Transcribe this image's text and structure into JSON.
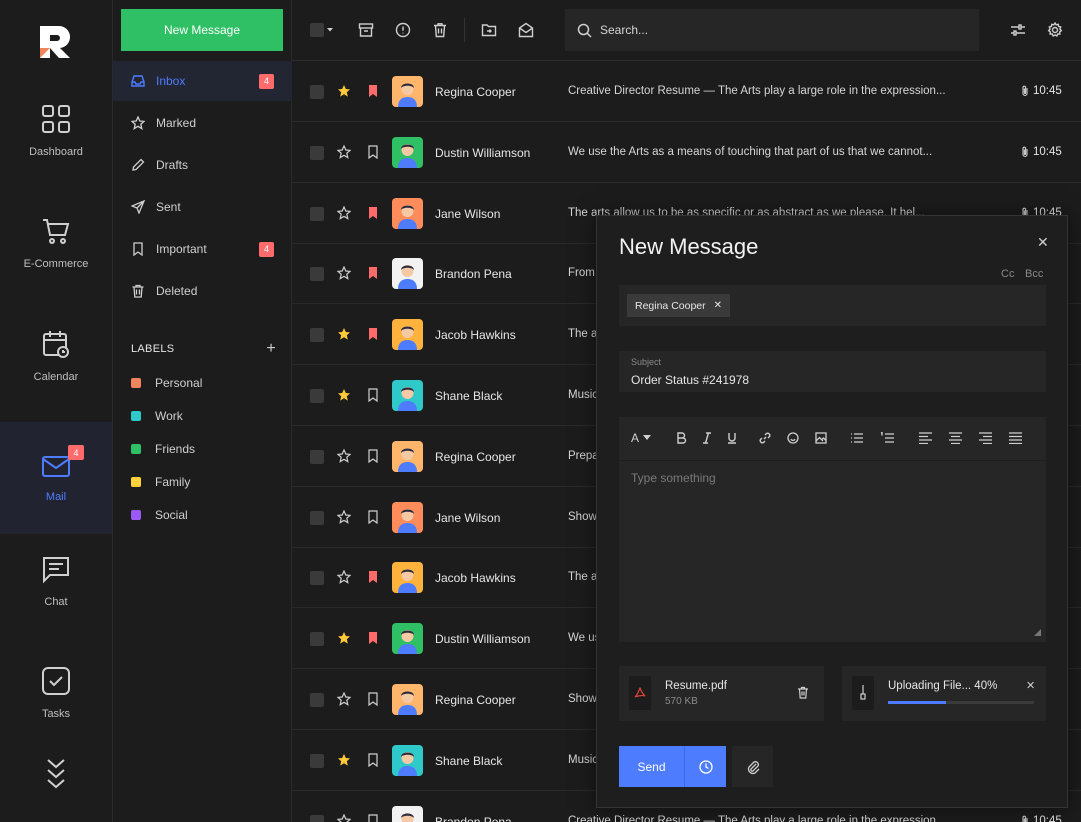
{
  "colors": {
    "accent": "#4e7cff",
    "new_button": "#2fbf64",
    "badge": "#ff6b6b",
    "star": "#ffc93c",
    "bookmark": "#ff6b6b"
  },
  "rail": {
    "items": [
      {
        "label": "Dashboard",
        "icon": "grid-icon"
      },
      {
        "label": "E-Commerce",
        "icon": "cart-icon"
      },
      {
        "label": "Calendar",
        "icon": "calendar-icon"
      },
      {
        "label": "Mail",
        "icon": "mail-icon",
        "badge": "4",
        "active": true
      },
      {
        "label": "Chat",
        "icon": "chat-icon"
      },
      {
        "label": "Tasks",
        "icon": "tasks-icon"
      }
    ]
  },
  "folders": {
    "new_message": "New Message",
    "items": [
      {
        "label": "Inbox",
        "count": "4",
        "active": true
      },
      {
        "label": "Marked"
      },
      {
        "label": "Drafts"
      },
      {
        "label": "Sent"
      },
      {
        "label": "Important",
        "count": "4"
      },
      {
        "label": "Deleted"
      }
    ],
    "labels_heading": "LABELS",
    "labels": [
      {
        "label": "Personal",
        "color": "#f0845c"
      },
      {
        "label": "Work",
        "color": "#2fc9c9"
      },
      {
        "label": "Friends",
        "color": "#2fbf64"
      },
      {
        "label": "Family",
        "color": "#ffd23c"
      },
      {
        "label": "Social",
        "color": "#9b59f5"
      }
    ]
  },
  "search": {
    "placeholder": "Search..."
  },
  "messages": [
    {
      "name": "Regina Cooper",
      "snippet": "Creative Director Resume — The Arts play a large role in the expression...",
      "time": "10:45",
      "attachment": true,
      "starred": true,
      "bookmarked": true,
      "avatar_bg": "#ffb56b"
    },
    {
      "name": "Dustin Williamson",
      "snippet": "We use the Arts as a means of touching that part of us that we cannot...",
      "time": "10:45",
      "attachment": true,
      "starred": false,
      "bookmarked": false,
      "avatar_bg": "#2fbf64"
    },
    {
      "name": "Jane Wilson",
      "snippet": "The arts allow us to be as specific or as abstract as we please. It hel...",
      "time": "10:45",
      "attachment": true,
      "starred": false,
      "bookmarked": true,
      "avatar_bg": "#ff8c5a"
    },
    {
      "name": "Brandon Pena",
      "snippet": "From",
      "time": "",
      "attachment": false,
      "starred": false,
      "bookmarked": true,
      "avatar_bg": "#f2f2f2"
    },
    {
      "name": "Jacob Hawkins",
      "snippet": "The a",
      "time": "",
      "attachment": false,
      "starred": true,
      "bookmarked": true,
      "avatar_bg": "#ffb23c"
    },
    {
      "name": "Shane Black",
      "snippet": "Music",
      "time": "",
      "attachment": false,
      "starred": true,
      "bookmarked": false,
      "avatar_bg": "#2fc9c9"
    },
    {
      "name": "Regina Cooper",
      "snippet": "Prepa",
      "time": "",
      "attachment": false,
      "starred": false,
      "bookmarked": false,
      "avatar_bg": "#ffb56b"
    },
    {
      "name": "Jane Wilson",
      "snippet": "Show",
      "time": "",
      "attachment": false,
      "starred": false,
      "bookmarked": false,
      "avatar_bg": "#ff8c5a"
    },
    {
      "name": "Jacob Hawkins",
      "snippet": "The a",
      "time": "",
      "attachment": false,
      "starred": false,
      "bookmarked": true,
      "avatar_bg": "#ffb23c"
    },
    {
      "name": "Dustin Williamson",
      "snippet": "We us",
      "time": "",
      "attachment": false,
      "starred": true,
      "bookmarked": true,
      "avatar_bg": "#2fbf64"
    },
    {
      "name": "Regina Cooper",
      "snippet": "Show",
      "time": "",
      "attachment": false,
      "starred": false,
      "bookmarked": false,
      "avatar_bg": "#ffb56b"
    },
    {
      "name": "Shane Black",
      "snippet": "Music",
      "time": "",
      "attachment": false,
      "starred": true,
      "bookmarked": false,
      "avatar_bg": "#2fc9c9"
    },
    {
      "name": "Brandon Pena",
      "snippet": "Creative Director Resume — The Arts play a large role in the expression...",
      "time": "10:45",
      "attachment": true,
      "starred": false,
      "bookmarked": false,
      "avatar_bg": "#f2f2f2"
    }
  ],
  "compose": {
    "title": "New Message",
    "cc": "Cc",
    "bcc": "Bcc",
    "recipient": "Regina Cooper",
    "subject_label": "Subject",
    "subject": "Order Status #241978",
    "body_placeholder": "Type something",
    "font_button": "A",
    "attachments": [
      {
        "name": "Resume.pdf",
        "size": "570 KB"
      },
      {
        "name": "Uploading File... 40%",
        "progress": 0.4
      }
    ],
    "send_label": "Send"
  }
}
